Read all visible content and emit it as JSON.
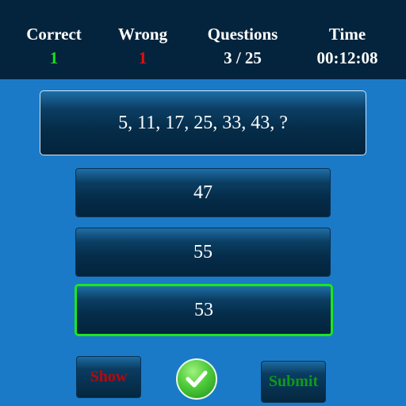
{
  "stats": {
    "correct_label": "Correct",
    "correct_value": "1",
    "wrong_label": "Wrong",
    "wrong_value": "1",
    "questions_label": "Questions",
    "questions_value": "3 / 25",
    "time_label": "Time",
    "time_value": "00:12:08"
  },
  "question": {
    "text": "5, 11, 17, 25, 33, 43, ?"
  },
  "answers": [
    "47",
    "55",
    "53"
  ],
  "selected_answer": "53",
  "buttons": {
    "show_label": "Show",
    "submit_label": "Submit",
    "check_icon": "checkmark-icon"
  },
  "colors": {
    "background": "#1a7ac7",
    "topbar": "#04243d",
    "correct": "#19e019",
    "wrong": "#e01010",
    "selected_border": "#1de61d",
    "show_text": "#b8080a",
    "submit_text": "#0d9a1b"
  }
}
